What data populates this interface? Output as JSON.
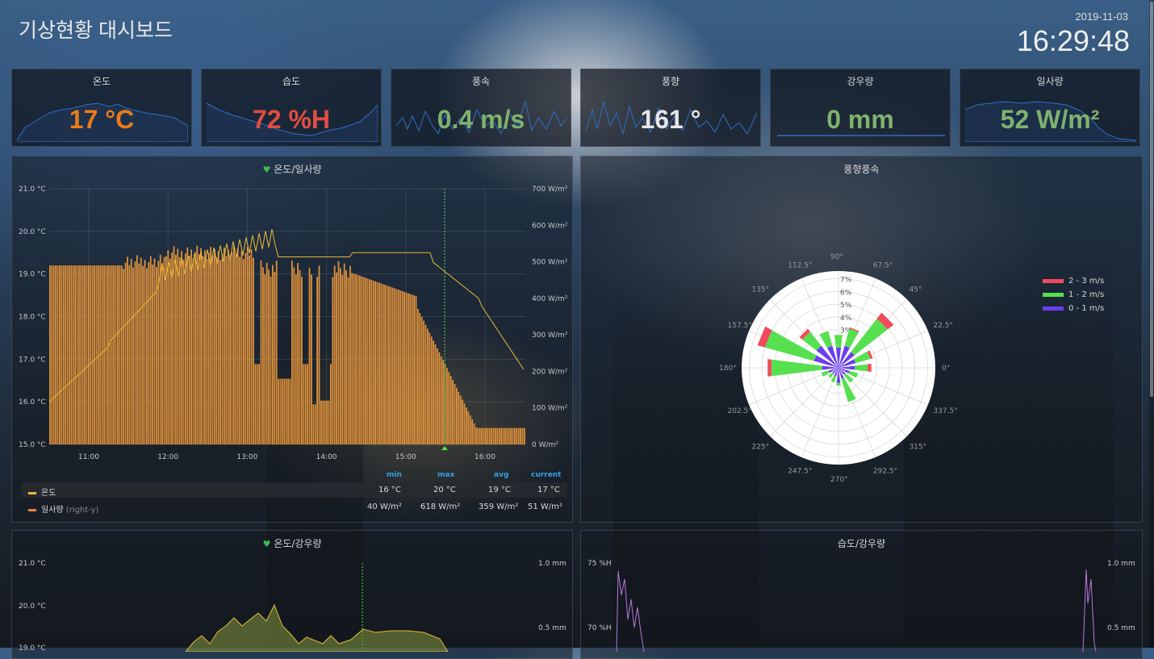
{
  "header": {
    "title": "기상현황 대시보드",
    "date": "2019-11-03",
    "time": "16:29:48"
  },
  "stats": [
    {
      "label": "온도",
      "value": "17 °C",
      "color": "#eb7b18"
    },
    {
      "label": "습도",
      "value": "72 %H",
      "color": "#e24d42"
    },
    {
      "label": "풍속",
      "value": "0.4 m/s",
      "color": "#7eb26d"
    },
    {
      "label": "풍향",
      "value": "161 °",
      "color": "#e5e5e5"
    },
    {
      "label": "강우량",
      "value": "0 mm",
      "color": "#7eb26d"
    },
    {
      "label": "일사량",
      "value": "52 W/m²",
      "color": "#7eb26d"
    }
  ],
  "temp_solar": {
    "title": "온도/일사량",
    "y_left": [
      "21.0 °C",
      "20.0 °C",
      "19.0 °C",
      "18.0 °C",
      "17.0 °C",
      "16.0 °C",
      "15.0 °C"
    ],
    "y_right": [
      "700 W/m²",
      "600 W/m²",
      "500 W/m²",
      "400 W/m²",
      "300 W/m²",
      "200 W/m²",
      "100 W/m²",
      "0 W/m²"
    ],
    "x": [
      "11:00",
      "12:00",
      "13:00",
      "14:00",
      "15:00",
      "16:00"
    ],
    "legend": {
      "headers": [
        "min",
        "max",
        "avg",
        "current"
      ],
      "rows": [
        {
          "name": "온도",
          "note": "",
          "min": "16 °C",
          "max": "20 °C",
          "avg": "19 °C",
          "current": "17 °C",
          "color": "#eab839"
        },
        {
          "name": "일사량",
          "note": "(right-y)",
          "min": "40 W/m²",
          "max": "618 W/m²",
          "avg": "359 W/m²",
          "current": "51 W/m²",
          "color": "#ef843c"
        }
      ]
    }
  },
  "wind": {
    "title": "풍향풍속",
    "radial": [
      "7%",
      "6%",
      "5%",
      "4%",
      "3%"
    ],
    "angles": [
      "90°",
      "67.5°",
      "45°",
      "22.5°",
      "0°",
      "337.5°",
      "315°",
      "292.5°",
      "270°",
      "247.5°",
      "225°",
      "202.5°",
      "180°",
      "157.5°",
      "135°",
      "112.5°"
    ],
    "legend": [
      {
        "label": "2 - 3 m/s",
        "color": "#f2495c"
      },
      {
        "label": "1 - 2 m/s",
        "color": "#56e04f"
      },
      {
        "label": "0 - 1 m/s",
        "color": "#6b3ef0"
      }
    ]
  },
  "temp_rain": {
    "title": "온도/강우량",
    "y_left": [
      "21.0 °C",
      "20.0 °C",
      "19.0 °C"
    ],
    "y_right": [
      "1.0 mm",
      "0.5 mm"
    ]
  },
  "hum_rain": {
    "title": "습도/강우량",
    "y_left": [
      "75 %H",
      "70 %H"
    ],
    "y_right": [
      "1.0 mm",
      "0.5 mm"
    ]
  }
}
